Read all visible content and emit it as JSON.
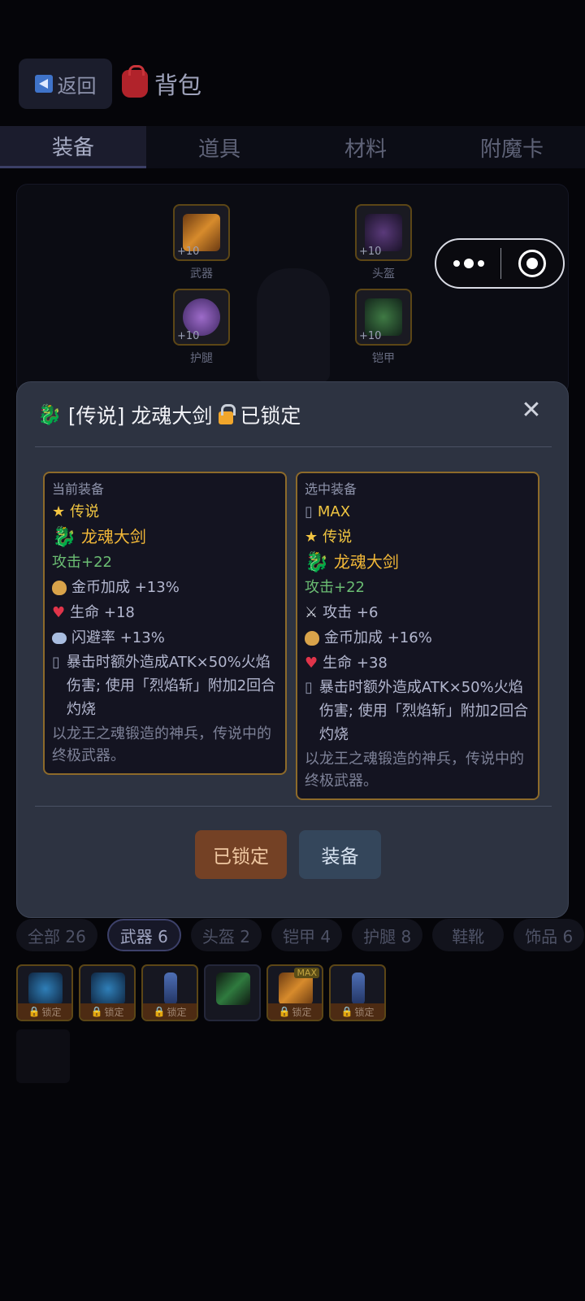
{
  "header": {
    "back_label": "返回",
    "title": "背包"
  },
  "tabs": [
    {
      "label": "装备",
      "active": true
    },
    {
      "label": "道具",
      "active": false
    },
    {
      "label": "材料",
      "active": false
    },
    {
      "label": "附魔卡",
      "active": false
    }
  ],
  "equip_slots": [
    {
      "label": "武器",
      "level": "+10"
    },
    {
      "label": "头盔",
      "level": "+10"
    },
    {
      "label": "护腿",
      "level": "+10"
    },
    {
      "label": "铠甲",
      "level": "+10"
    }
  ],
  "modal": {
    "title": "[传说] 龙魂大剑",
    "lock_status": "已锁定",
    "current": {
      "header": "当前装备",
      "rarity": "传说",
      "name": "龙魂大剑",
      "attack": "攻击+22",
      "stats": [
        {
          "icon": "money-bag-icon",
          "text": "金币加成 +13%"
        },
        {
          "icon": "heart-icon",
          "text": "生命 +18"
        },
        {
          "icon": "wind-icon",
          "text": "闪避率 +13%"
        }
      ],
      "skill": "暴击时额外造成ATK×50%火焰伤害; 使用「烈焰斩」附加2回合灼烧",
      "desc": "以龙王之魂锻造的神兵，传说中的终极武器。"
    },
    "selected": {
      "header": "选中装备",
      "max": "MAX",
      "rarity": "传说",
      "name": "龙魂大剑",
      "attack": "攻击+22",
      "stats": [
        {
          "icon": "swords-icon",
          "text": "攻击 +6"
        },
        {
          "icon": "money-bag-icon",
          "text": "金币加成 +16%"
        },
        {
          "icon": "heart-icon",
          "text": "生命 +38"
        }
      ],
      "skill": "暴击时额外造成ATK×50%火焰伤害; 使用「烈焰斩」附加2回合灼烧",
      "desc": "以龙王之魂锻造的神兵，传说中的终极武器。"
    },
    "btn_locked": "已锁定",
    "btn_equip": "装备"
  },
  "filters": [
    {
      "label": "全部 26",
      "active": false
    },
    {
      "label": "武器 6",
      "active": true
    },
    {
      "label": "头盔 2",
      "active": false
    },
    {
      "label": "铠甲 4",
      "active": false
    },
    {
      "label": "护腿 8",
      "active": false
    },
    {
      "label": "鞋靴",
      "active": false
    },
    {
      "label": "饰品 6",
      "active": false
    }
  ],
  "items": [
    {
      "lock": "锁定",
      "max": ""
    },
    {
      "lock": "锁定",
      "max": ""
    },
    {
      "lock": "锁定",
      "max": ""
    },
    {
      "lock": "",
      "max": ""
    },
    {
      "lock": "锁定",
      "max": "MAX"
    },
    {
      "lock": "锁定",
      "max": ""
    }
  ],
  "icons": {
    "star": "★",
    "dragon": "🐉",
    "close": "✕",
    "skill_glyph": "▯"
  },
  "colors": {
    "legendary": "#f2b838",
    "attack": "#6bbd73",
    "modal_bg": "#2d3341"
  }
}
